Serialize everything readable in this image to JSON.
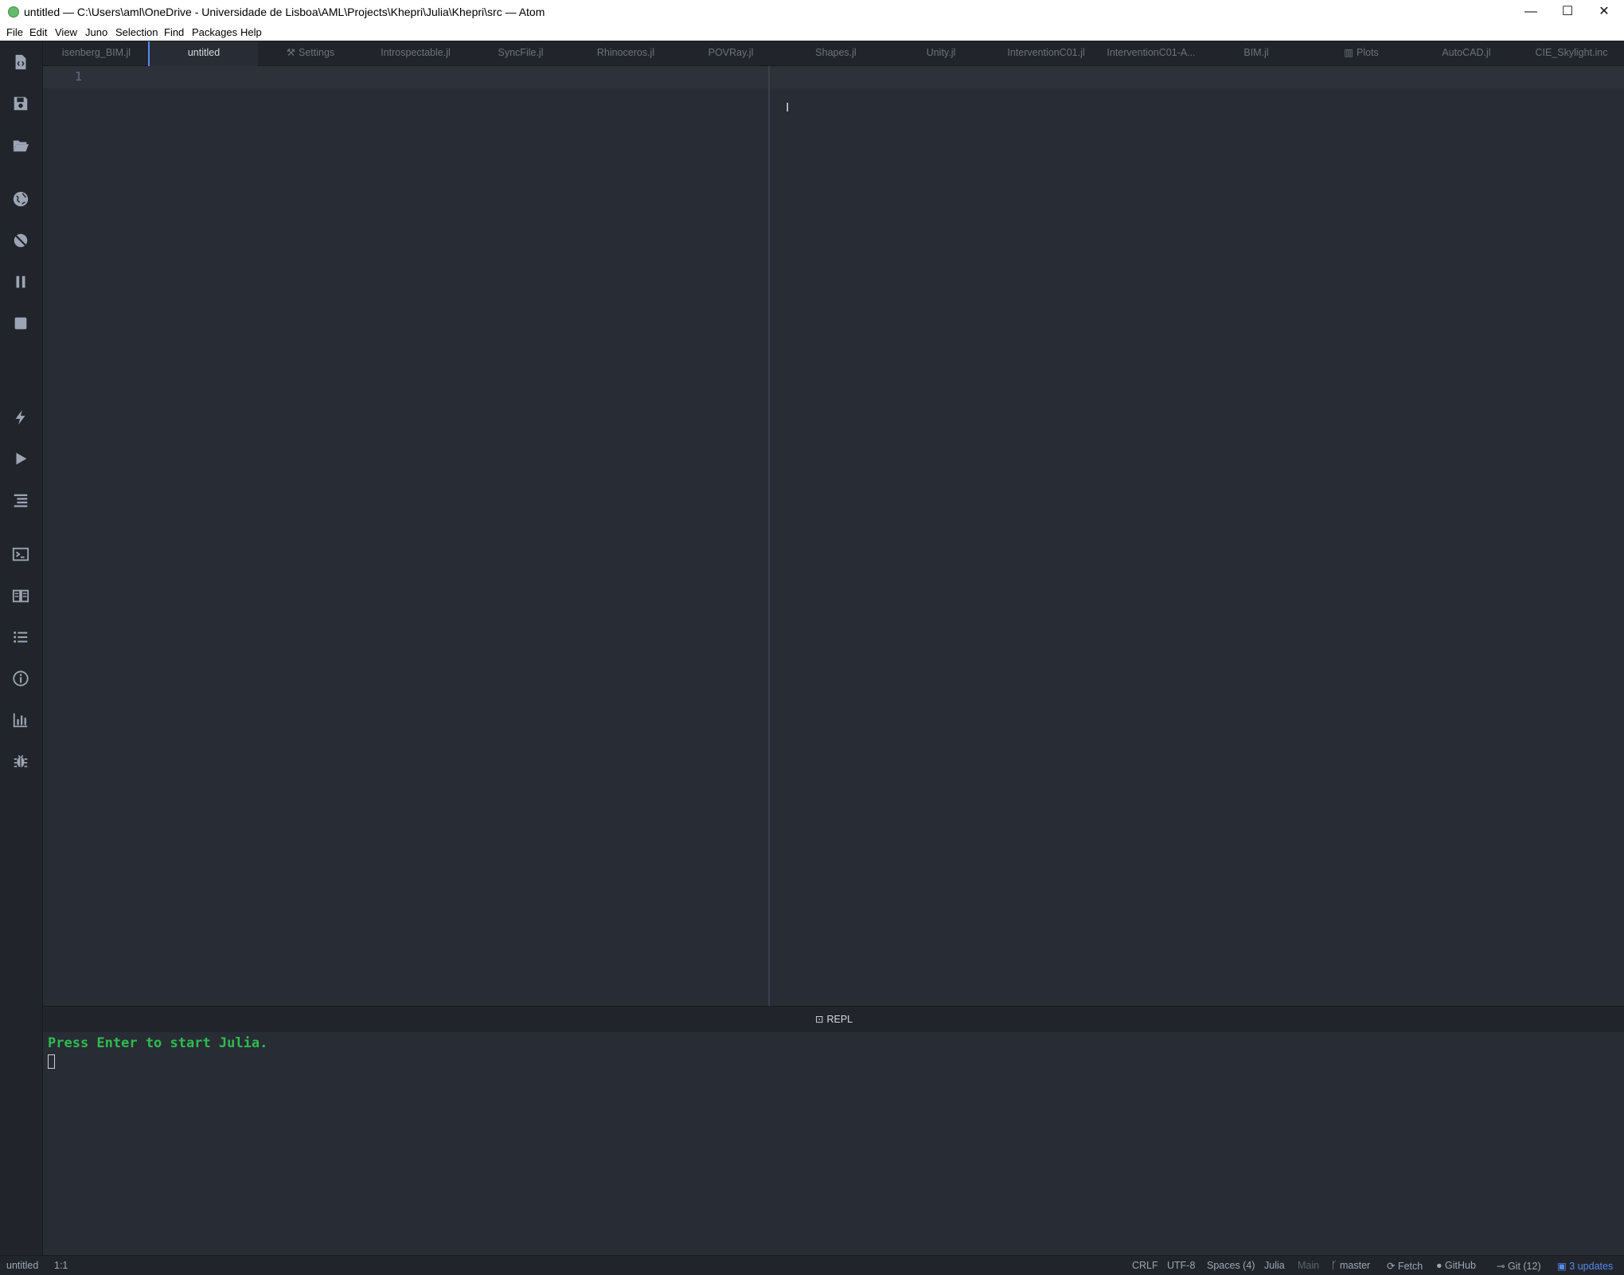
{
  "window": {
    "title": "untitled — C:\\Users\\aml\\OneDrive - Universidade de Lisboa\\AML\\Projects\\Khepri\\Julia\\Khepri\\src — Atom",
    "minimize": "—",
    "maximize": "☐",
    "close": "✕"
  },
  "menu": [
    "File",
    "Edit",
    "View",
    "Juno",
    "Selection",
    "Find",
    "Packages",
    "Help"
  ],
  "tabs": [
    {
      "label": "isenberg_BIM.jl"
    },
    {
      "label": "untitled"
    },
    {
      "label": "Settings"
    },
    {
      "label": "Introspectable.jl"
    },
    {
      "label": "SyncFile.jl"
    },
    {
      "label": "Rhinoceros.jl"
    },
    {
      "label": "POVRay.jl"
    },
    {
      "label": "Shapes.jl"
    },
    {
      "label": "Unity.jl"
    },
    {
      "label": "InterventionC01.jl"
    },
    {
      "label": "InterventionC01-A..."
    },
    {
      "label": "BIM.jl"
    },
    {
      "label": "Plots"
    },
    {
      "label": "AutoCAD.jl"
    },
    {
      "label": "CIE_Skylight.inc"
    }
  ],
  "editor": {
    "line_number": "1"
  },
  "repl": {
    "title": "REPL",
    "prompt": "Press Enter to start Julia."
  },
  "status": {
    "file": "untitled",
    "cursor": "1:1",
    "line_ending": "CRLF",
    "encoding": "UTF-8",
    "indent": "Spaces (4)",
    "grammar": "Julia",
    "module": "Main",
    "branch": "master",
    "fetch": "Fetch",
    "github": "GitHub",
    "git": "Git (12)",
    "updates": "3 updates"
  },
  "colors": {
    "accent": "#568af2",
    "prompt_green": "#2fbb4f",
    "background": "#282c34"
  }
}
